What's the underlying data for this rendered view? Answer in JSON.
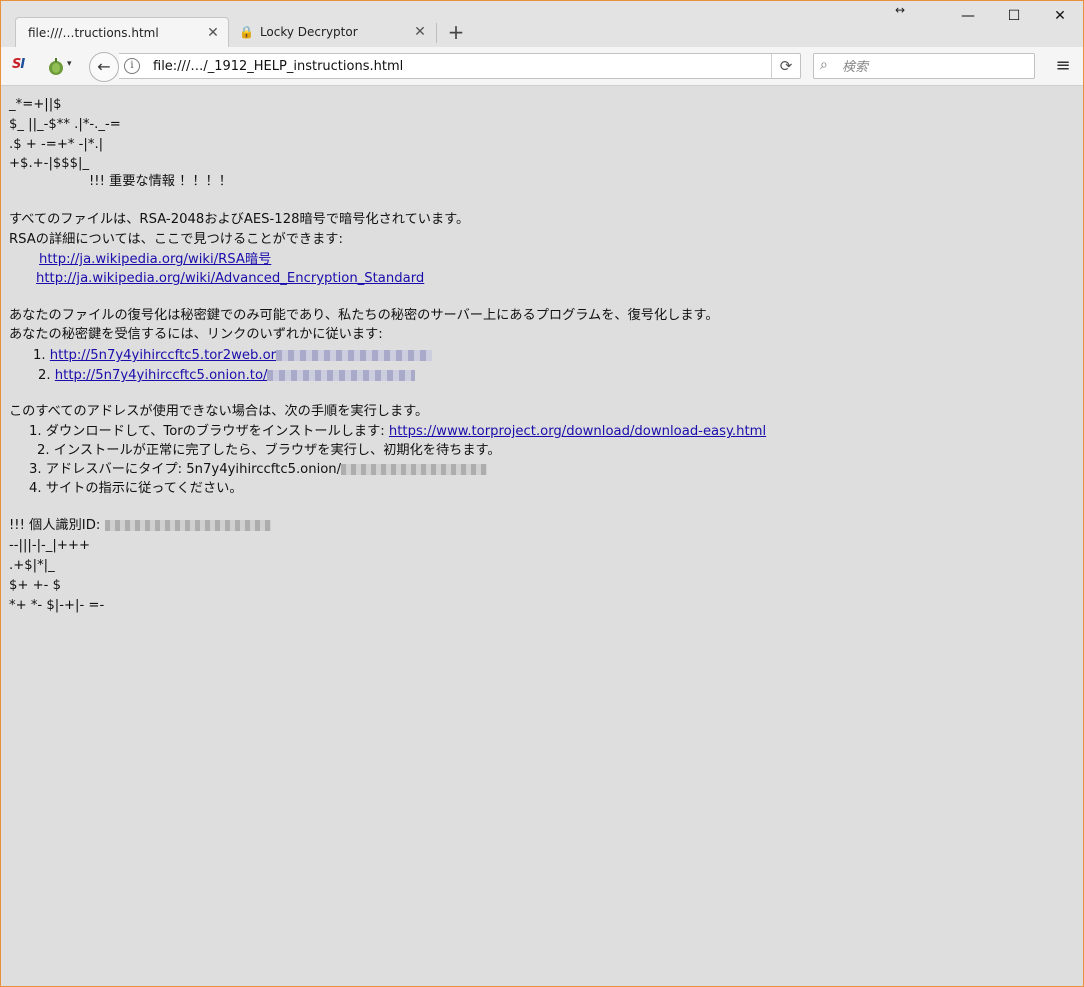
{
  "browser": {
    "tabs": [
      {
        "title": "file:///…tructions.html",
        "active": true
      },
      {
        "title": "Locky Decryptor",
        "active": false
      }
    ],
    "address": "file:///…/_1912_HELP_instructions.html",
    "search_placeholder": "検索",
    "logo_text_red": "S",
    "logo_text_blue": "I",
    "resize_indicator": "↔",
    "icons": {
      "close": "✕",
      "new_tab": "+",
      "minimize": "—",
      "maximize": "☐",
      "window_close": "✕",
      "back": "←",
      "info": "i",
      "reload": "⟳",
      "search": "⌕",
      "menu": "≡",
      "lock": "🔒",
      "dropdown": "▾"
    }
  },
  "page": {
    "art_top": [
      "_*=+||$",
      "$_ ||_-$** .|*-._-=",
      ".$ + -=+* -|*.|",
      "+$.+-|$$$|_"
    ],
    "heading": "!!!  重要な情報 ！！！！",
    "para1_line1": "すべてのファイルは、RSA-2048およびAES-128暗号で暗号化されています。",
    "para1_line2": "RSAの詳細については、ここで見つけることができます:",
    "link1": "http://ja.wikipedia.org/wiki/RSA暗号",
    "link2": "http://ja.wikipedia.org/wiki/Advanced_Encryption_Standard",
    "para2_line1": "あなたのファイルの復号化は秘密鍵でのみ可能であり、私たちの秘密のサーバー上にあるプログラムを、復号化します。",
    "para2_line2": "あなたの秘密鍵を受信するには、リンクのいずれかに従います:",
    "list1_num1": "1.",
    "list1_link1": "http://5n7y4yihirccftc5.tor2web.or",
    "list1_num2": "2.",
    "list1_link2": "http://5n7y4yihirccftc5.onion.to/",
    "para3": "このすべてのアドレスが使用できない場合は、次の手順を実行します。",
    "step1_text": "1. ダウンロードして、Torのブラウザをインストールします:",
    "step1_link": "https://www.torproject.org/download/download-easy.html",
    "step2": "2.  インストールが正常に完了したら、ブラウザを実行し、初期化を待ちます。",
    "step3": "3.  アドレスバーにタイプ:  5n7y4yihirccftc5.onion/",
    "step4": "4. サイトの指示に従ってください。",
    "id_label": "!!! 個人識別ID:",
    "art_bottom": [
      "--|||-|-_|+++",
      ".+$|*|_",
      "$+ +- $",
      "*+ *- $|-+|- =-"
    ]
  }
}
